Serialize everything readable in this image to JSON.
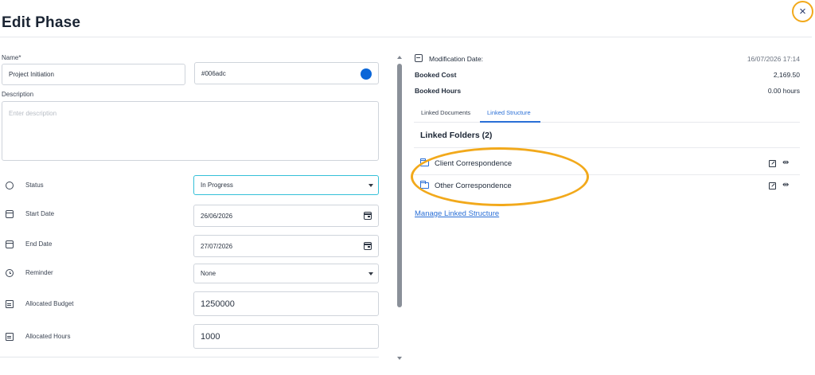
{
  "header": {
    "title": "Edit Phase",
    "close_glyph": "×"
  },
  "form": {
    "name_label": "Name*",
    "name_value": "Project Initiation",
    "color_value": "#006adc",
    "color_swatch": "#0a66d8",
    "description_label": "Description",
    "description_placeholder": "Enter description",
    "rows": {
      "status": {
        "label": "Status",
        "value": "In Progress",
        "icon": "circle-icon"
      },
      "start_date": {
        "label": "Start Date",
        "value": "26/06/2026",
        "icon": "calendar-icon"
      },
      "end_date": {
        "label": "End Date",
        "value": "27/07/2026",
        "icon": "calendar-icon"
      },
      "reminder": {
        "label": "Reminder",
        "value": "None",
        "icon": "clock-icon"
      },
      "allocated_budget": {
        "label": "Allocated Budget",
        "value": "1250000",
        "icon": "budget-icon"
      },
      "allocated_hours": {
        "label": "Allocated Hours",
        "value": "1000",
        "icon": "budget-icon"
      }
    }
  },
  "details": {
    "modification_date_label": "Modification Date:",
    "modification_date_value": "16/07/2026 17:14",
    "booked_cost_label": "Booked Cost",
    "booked_cost_value": "2,169.50",
    "booked_hours_label": "Booked Hours",
    "booked_hours_value": "0.00 hours"
  },
  "tabs": [
    {
      "label": "Linked Documents",
      "active": false
    },
    {
      "label": "Linked Structure",
      "active": true
    }
  ],
  "linked_structure": {
    "section_title": "Linked Folders (2)",
    "folders": [
      {
        "label": "Client Correspondence"
      },
      {
        "label": "Other Correspondence"
      }
    ],
    "manage_link": "Manage Linked Structure"
  },
  "colors": {
    "accent": "#2a6fd6",
    "highlight": "#f2a91b",
    "focus_border": "#35c0d8"
  }
}
